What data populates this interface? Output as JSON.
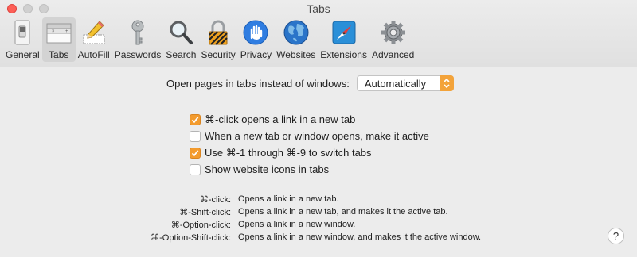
{
  "window": {
    "title": "Tabs"
  },
  "toolbar": {
    "items": [
      {
        "label": "General",
        "icon": "general-switch-icon"
      },
      {
        "label": "Tabs",
        "icon": "tabs-icon",
        "selected": true
      },
      {
        "label": "AutoFill",
        "icon": "pencil-icon"
      },
      {
        "label": "Passwords",
        "icon": "key-icon"
      },
      {
        "label": "Search",
        "icon": "magnifier-icon"
      },
      {
        "label": "Security",
        "icon": "lock-icon"
      },
      {
        "label": "Privacy",
        "icon": "hand-icon"
      },
      {
        "label": "Websites",
        "icon": "globe-icon"
      },
      {
        "label": "Extensions",
        "icon": "puzzle-compass-icon"
      },
      {
        "label": "Advanced",
        "icon": "gear-icon"
      }
    ]
  },
  "open_pages": {
    "label": "Open pages in tabs instead of windows:",
    "value": "Automatically"
  },
  "checkboxes": [
    {
      "label": "⌘-click opens a link in a new tab",
      "checked": true
    },
    {
      "label": "When a new tab or window opens, make it active",
      "checked": false
    },
    {
      "label": "Use ⌘-1 through ⌘-9 to switch tabs",
      "checked": true
    },
    {
      "label": "Show website icons in tabs",
      "checked": false
    }
  ],
  "shortcuts": [
    {
      "key": "⌘-click:",
      "desc": "Opens a link in a new tab."
    },
    {
      "key": "⌘-Shift-click:",
      "desc": "Opens a link in a new tab, and makes it the active tab."
    },
    {
      "key": "⌘-Option-click:",
      "desc": "Opens a link in a new window."
    },
    {
      "key": "⌘-Option-Shift-click:",
      "desc": "Opens a link in a new window, and makes it the active window."
    }
  ],
  "help": {
    "label": "?"
  },
  "colors": {
    "accent": "#f39b2e",
    "background": "#ececec"
  }
}
